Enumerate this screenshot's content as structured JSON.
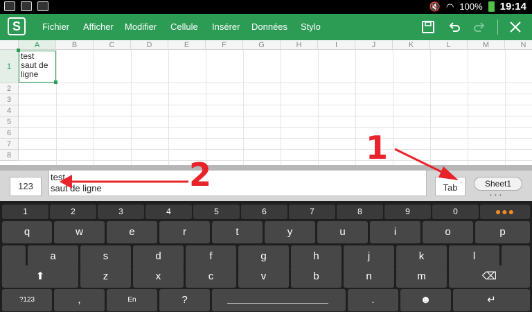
{
  "status_bar": {
    "battery": "100%",
    "time": "19:14"
  },
  "toolbar": {
    "app_logo": "S",
    "menu": [
      "Fichier",
      "Afficher",
      "Modifier",
      "Cellule",
      "Insérer",
      "Données",
      "Stylo"
    ]
  },
  "sheet": {
    "columns": [
      "A",
      "B",
      "C",
      "D",
      "E",
      "F",
      "G",
      "H",
      "I",
      "J",
      "K",
      "L",
      "M",
      "N"
    ],
    "rows": [
      "1",
      "2",
      "3",
      "4",
      "5",
      "6",
      "7",
      "8"
    ],
    "cell_a1_lines": [
      "test",
      "saut de",
      "ligne"
    ]
  },
  "edit_bar": {
    "num_label": "123",
    "input_lines": [
      "test",
      "saut de ligne"
    ],
    "tab_label": "Tab",
    "sheet_tab": "Sheet1"
  },
  "annotations": {
    "label1": "1",
    "label2": "2",
    "color": "#e8232a"
  },
  "keyboard": {
    "number_row": [
      "1",
      "2",
      "3",
      "4",
      "5",
      "6",
      "7",
      "8",
      "9",
      "0"
    ],
    "row1": [
      "q",
      "w",
      "e",
      "r",
      "t",
      "y",
      "u",
      "i",
      "o",
      "p"
    ],
    "row2": [
      "a",
      "s",
      "d",
      "f",
      "g",
      "h",
      "j",
      "k",
      "l"
    ],
    "row3": [
      "z",
      "x",
      "c",
      "v",
      "b",
      "n",
      "m"
    ],
    "sym_label": "?123",
    "comma": ",",
    "lang_label": "En",
    "question": "?",
    "period": "."
  }
}
